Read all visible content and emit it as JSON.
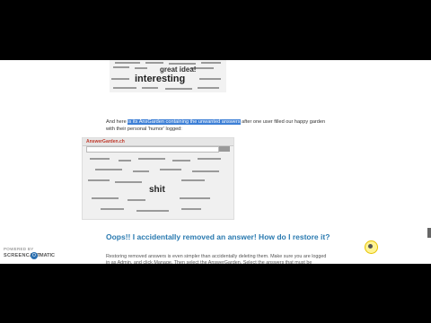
{
  "cloud_top": {
    "words_big": [
      "great idea!",
      "interesting"
    ]
  },
  "paragraph": {
    "pre": "And here ",
    "link": "is its AnsGarden containing the unwanted answers",
    "post": " after one user filled our happy garden with their personal 'humor' logged:"
  },
  "screenshot2": {
    "logo": "AnswerGarden.ch",
    "big_word": "shit"
  },
  "section": {
    "heading": "Oops!! I accidentally removed an answer! How do I restore it?",
    "body": "Restoring removed answers is even simpler than accidentally deleting them. Make sure you are logged in as Admin, and click Manage. Then select the AnswerGarden. Select the answers that must be restored and click"
  },
  "badge": {
    "line1": "POWERED BY",
    "line2": "SCREENCAST",
    "line3": "MATIC",
    "dot": "O"
  },
  "colors": {
    "link_highlight": "#3d7fd6",
    "heading": "#2a7ab0",
    "cursor_halo": "#ffeb3b"
  }
}
